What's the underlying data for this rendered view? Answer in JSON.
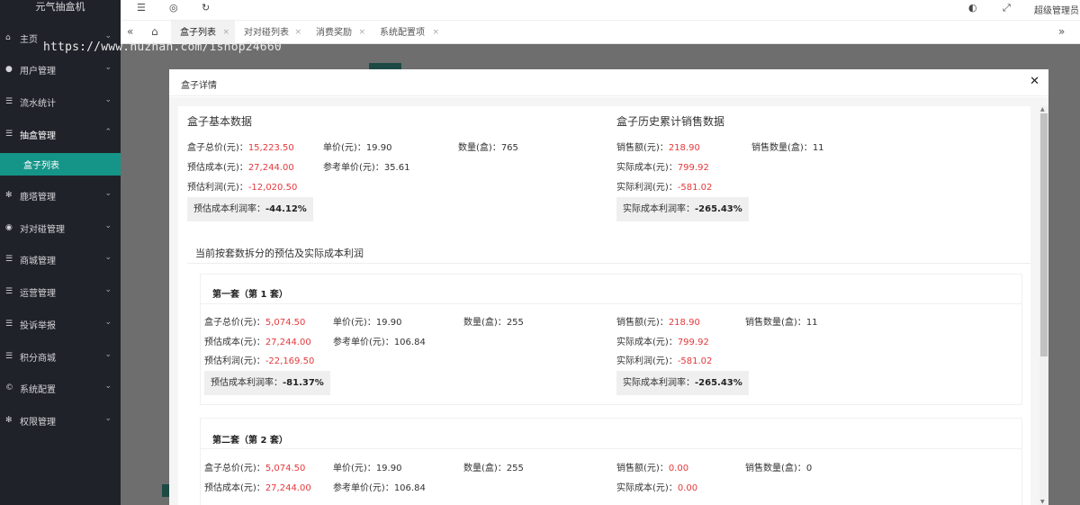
{
  "app": {
    "logo_text": "元气抽盒机"
  },
  "sidebar": {
    "items": [
      {
        "label": "主页",
        "icon": "home-icon"
      },
      {
        "label": "用户管理",
        "icon": "user-icon"
      },
      {
        "label": "流水统计",
        "icon": "list-icon"
      },
      {
        "label": "抽盒管理",
        "icon": "list-icon"
      },
      {
        "label": "鹿塔管理",
        "icon": "gear-icon"
      },
      {
        "label": "对对碰管理",
        "icon": "pin-icon"
      },
      {
        "label": "商城管理",
        "icon": "list-icon"
      },
      {
        "label": "运营管理",
        "icon": "list-icon"
      },
      {
        "label": "投诉举报",
        "icon": "list-icon"
      },
      {
        "label": "积分商城",
        "icon": "list-icon"
      },
      {
        "label": "系统配置",
        "icon": "copyright-icon"
      },
      {
        "label": "权限管理",
        "icon": "gear-icon"
      }
    ],
    "subitem": "盒子列表"
  },
  "header": {
    "user": "超级管理员"
  },
  "tabs": [
    {
      "label": "盒子列表",
      "active": true
    },
    {
      "label": "对对碰列表",
      "active": false
    },
    {
      "label": "消费奖励",
      "active": false
    },
    {
      "label": "系统配置项",
      "active": false
    }
  ],
  "watermark": "https://www.huzhan.com/ishop24660",
  "modal": {
    "title": "盒子详情",
    "basic": {
      "title": "盒子基本数据",
      "total_price_label": "盒子总价(元)：",
      "total_price": "15,223.50",
      "unit_price_label": "单价(元)：",
      "unit_price": "19.90",
      "qty_label": "数量(盒)：",
      "qty": "765",
      "est_cost_label": "预估成本(元)：",
      "est_cost": "27,244.00",
      "ref_unit_label": "参考单价(元)：",
      "ref_unit": "35.61",
      "est_profit_label": "预估利润(元)：",
      "est_profit": "-12,020.50",
      "est_rate_label": "预估成本利润率：",
      "est_rate": "-44.12%"
    },
    "history": {
      "title": "盒子历史累计销售数据",
      "sales_label": "销售额(元)：",
      "sales": "218.90",
      "sales_qty_label": "销售数量(盒)：",
      "sales_qty": "11",
      "act_cost_label": "实际成本(元)：",
      "act_cost": "799.92",
      "act_profit_label": "实际利润(元)：",
      "act_profit": "-581.02",
      "act_rate_label": "实际成本利润率：",
      "act_rate": "-265.43%"
    },
    "split_title": "当前按套数拆分的预估及实际成本利润",
    "sets": [
      {
        "title": "第一套（第 1 套）",
        "total_price": "5,074.50",
        "unit_price": "19.90",
        "qty": "255",
        "est_cost": "27,244.00",
        "ref_unit": "106.84",
        "est_profit": "-22,169.50",
        "est_rate": "-81.37%",
        "sales": "218.90",
        "sales_qty": "11",
        "act_cost": "799.92",
        "act_profit": "-581.02",
        "act_rate": "-265.43%"
      },
      {
        "title": "第二套（第 2 套）",
        "total_price": "5,074.50",
        "unit_price": "19.90",
        "qty": "255",
        "est_cost": "27,244.00",
        "ref_unit": "106.84",
        "sales": "0.00",
        "sales_qty": "0",
        "act_cost": "0.00"
      }
    ]
  }
}
